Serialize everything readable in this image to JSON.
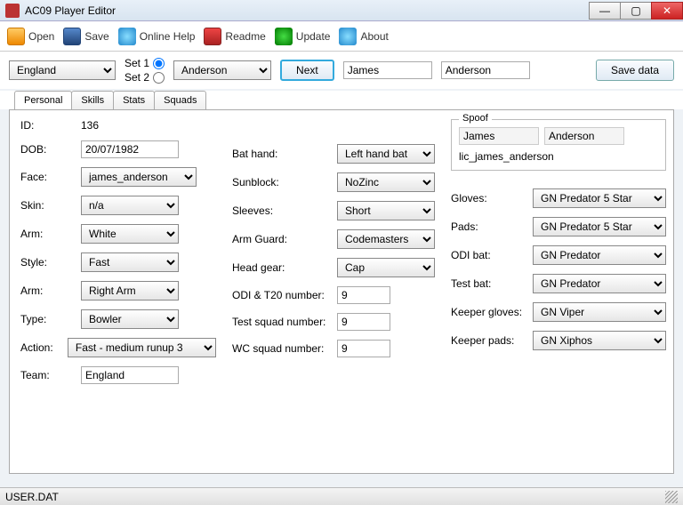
{
  "window": {
    "title": "AC09 Player Editor"
  },
  "toolbar": {
    "open": "Open",
    "save": "Save",
    "help": "Online Help",
    "readme": "Readme",
    "update": "Update",
    "about": "About"
  },
  "toprow": {
    "country": "England",
    "set1_label": "Set 1",
    "set2_label": "Set 2",
    "player_select": "Anderson",
    "next": "Next",
    "firstname": "James",
    "lastname": "Anderson",
    "savedata": "Save data"
  },
  "tabs": {
    "personal": "Personal",
    "skills": "Skills",
    "stats": "Stats",
    "squads": "Squads"
  },
  "labels": {
    "id": "ID:",
    "dob": "DOB:",
    "face": "Face:",
    "skin": "Skin:",
    "arm1": "Arm:",
    "style": "Style:",
    "arm2": "Arm:",
    "type": "Type:",
    "action": "Action:",
    "team": "Team:",
    "bathand": "Bat hand:",
    "sunblock": "Sunblock:",
    "sleeves": "Sleeves:",
    "armguard": "Arm Guard:",
    "headgear": "Head gear:",
    "odinum": "ODI & T20 number:",
    "testnum": "Test squad number:",
    "wcnum": "WC squad number:",
    "spoof": "Spoof",
    "gloves": "Gloves:",
    "pads": "Pads:",
    "odibat": "ODI bat:",
    "testbat": "Test bat:",
    "kgloves": "Keeper gloves:",
    "kpads": "Keeper pads:"
  },
  "values": {
    "id": "136",
    "dob": "20/07/1982",
    "face": "james_anderson",
    "skin": "n/a",
    "arm1": "White",
    "style": "Fast",
    "arm2": "Right Arm",
    "type": "Bowler",
    "action": "Fast - medium runup 3",
    "team": "England",
    "bathand": "Left hand bat",
    "sunblock": "NoZinc",
    "sleeves": "Short",
    "armguard": "Codemasters",
    "headgear": "Cap",
    "odinum": "9",
    "testnum": "9",
    "wcnum": "9",
    "spoof_first": "James",
    "spoof_last": "Anderson",
    "spoof_lic": "lic_james_anderson",
    "gloves": "GN Predator 5 Star",
    "pads": "GN Predator 5 Star",
    "odibat": "GN Predator",
    "testbat": "GN Predator",
    "kgloves": "GN Viper",
    "kpads": "GN Xiphos"
  },
  "status": {
    "file": "USER.DAT"
  }
}
